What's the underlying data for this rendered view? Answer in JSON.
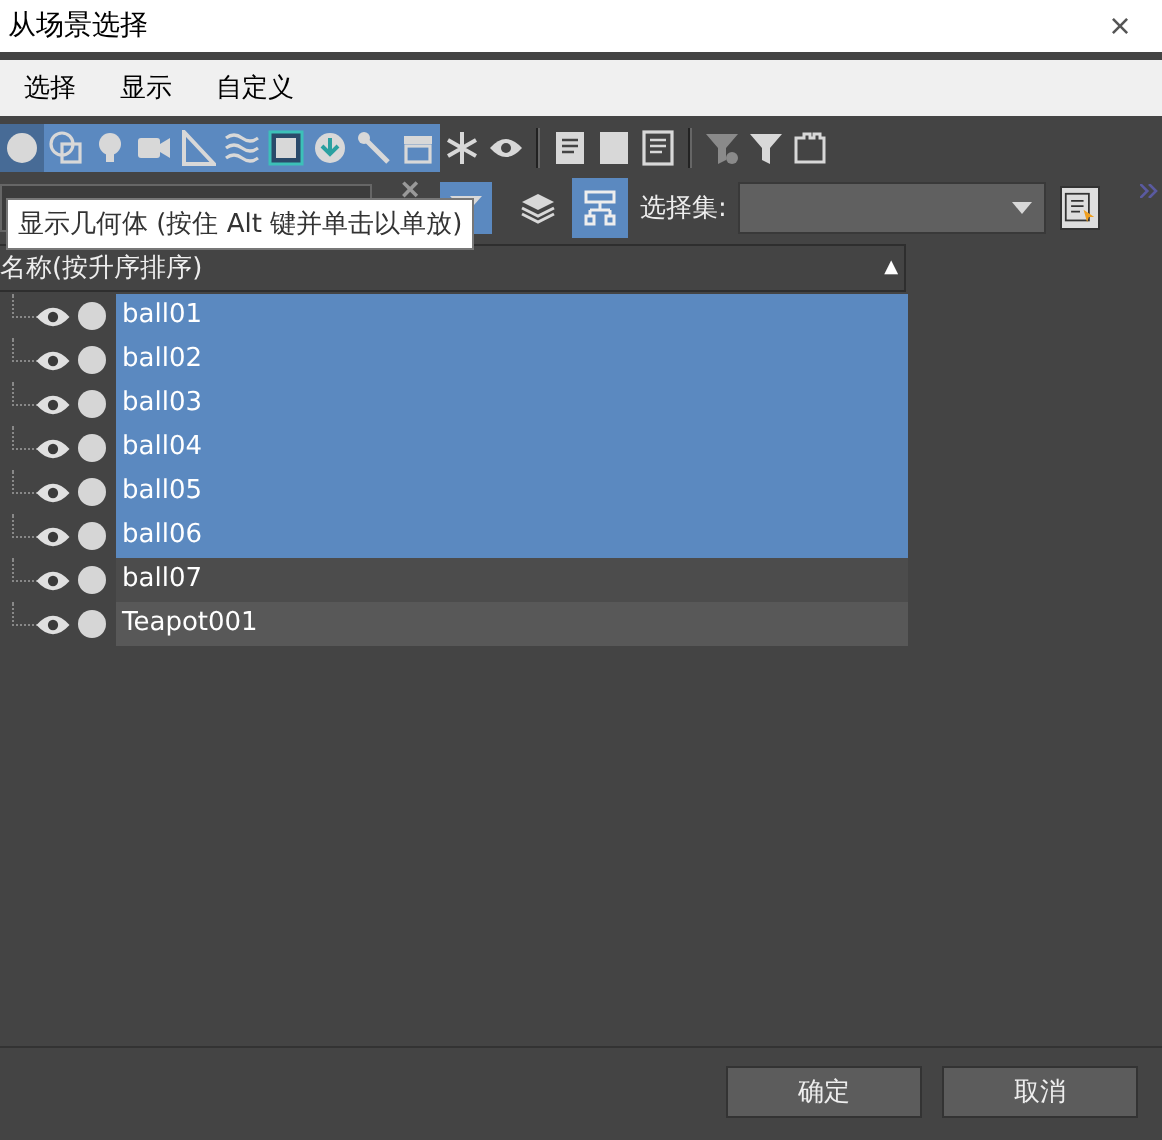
{
  "window": {
    "title": "从场景选择",
    "close": "×"
  },
  "menu": [
    "选择",
    "显示",
    "自定义"
  ],
  "toolbar": [
    {
      "kind": "sphere",
      "on": true,
      "selected": true
    },
    {
      "kind": "shapes",
      "on": true,
      "selected": false
    },
    {
      "kind": "light",
      "on": true,
      "selected": false
    },
    {
      "kind": "camera",
      "on": true,
      "selected": false
    },
    {
      "kind": "triangle",
      "on": true,
      "selected": false
    },
    {
      "kind": "waves",
      "on": true,
      "selected": false
    },
    {
      "kind": "group",
      "on": true,
      "selected": false
    },
    {
      "kind": "xref",
      "on": true,
      "selected": false
    },
    {
      "kind": "bone",
      "on": true,
      "selected": false
    },
    {
      "kind": "container",
      "on": true,
      "selected": false
    },
    {
      "kind": "snowflake",
      "on": false,
      "selected": false
    },
    {
      "kind": "eye",
      "on": false,
      "selected": false
    },
    {
      "kind": "sep"
    },
    {
      "kind": "doc",
      "on": false,
      "selected": false
    },
    {
      "kind": "square",
      "on": false,
      "selected": false
    },
    {
      "kind": "doc2",
      "on": false,
      "selected": false
    },
    {
      "kind": "sep"
    },
    {
      "kind": "filtergear",
      "on": false,
      "selected": false
    },
    {
      "kind": "filter",
      "on": false,
      "selected": false
    },
    {
      "kind": "bracket",
      "on": false,
      "selected": false
    }
  ],
  "search": {
    "clear": "×"
  },
  "selection_set": {
    "label": "选择集:"
  },
  "tooltip": "显示几何体 (按住 Alt 键并单击以单放)",
  "list": {
    "header": "名称(按升序排序)",
    "sort": "▲",
    "rows": [
      {
        "name": "ball01",
        "selected": true
      },
      {
        "name": "ball02",
        "selected": true
      },
      {
        "name": "ball03",
        "selected": true
      },
      {
        "name": "ball04",
        "selected": true
      },
      {
        "name": "ball05",
        "selected": true
      },
      {
        "name": "ball06",
        "selected": true
      },
      {
        "name": "ball07",
        "selected": false
      },
      {
        "name": "Teapot001",
        "selected": false
      }
    ]
  },
  "buttons": [
    "确定",
    "取消"
  ]
}
